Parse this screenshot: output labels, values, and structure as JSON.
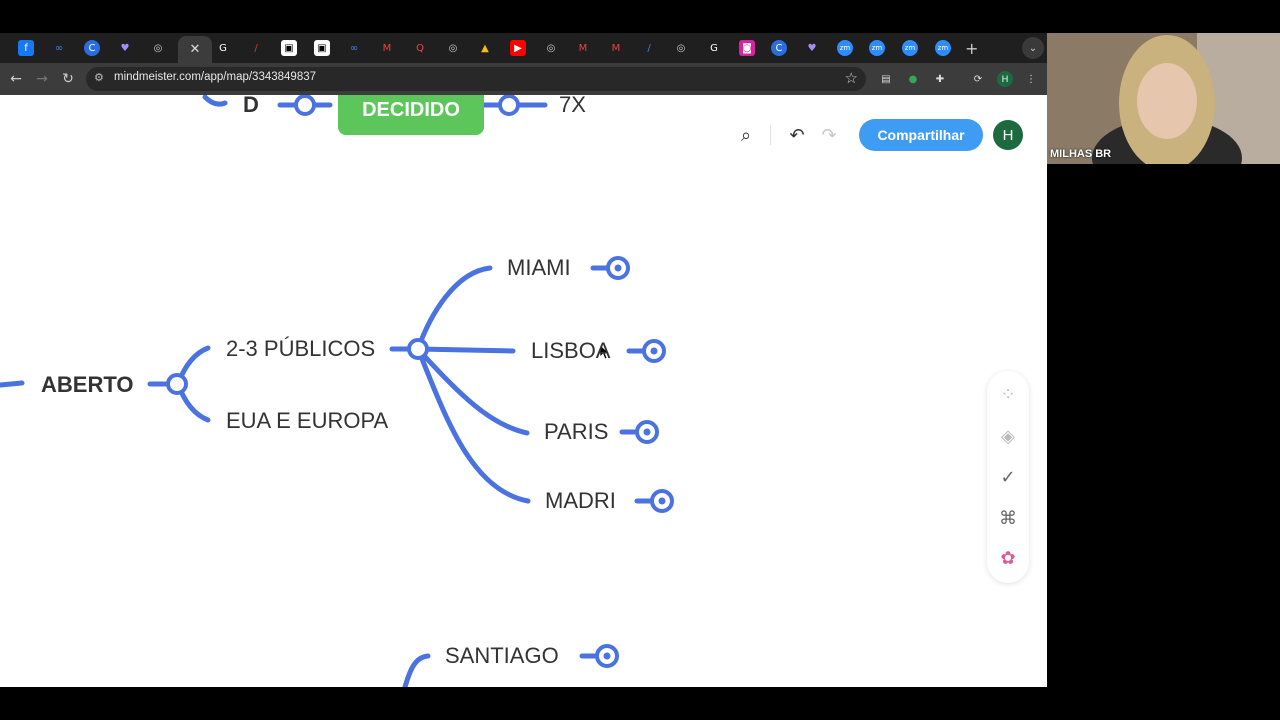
{
  "tabs": {
    "close_glyph": "✕",
    "favicons": [
      "f",
      "∞",
      "C",
      "♥",
      "◎",
      "G",
      "/",
      "▣",
      "▣",
      "∞",
      "M",
      "Q",
      "◎",
      "▲",
      "▶",
      "◎",
      "M",
      "M",
      "/",
      "◎",
      "G",
      "◙",
      "C",
      "♥",
      "zm",
      "zm",
      "zm",
      "zm"
    ],
    "new_tab": "+",
    "menu": "⌄"
  },
  "address_bar": {
    "url": "mindmeister.com/app/map/3343849837",
    "profile_initial": "H"
  },
  "mindmap": {
    "top_left_label": "D",
    "decided_label": "DECIDIDO",
    "top_right_label": "7X",
    "root": "ABERTO",
    "branch_1": "2-3 PÚBLICOS",
    "branch_2": "EUA E EUROPA",
    "cities": [
      "MIAMI",
      "LISBOA",
      "PARIS",
      "MADRI"
    ],
    "bottom_label": "SANTIAGO"
  },
  "toolbar": {
    "share_label": "Compartilhar",
    "avatar_initial": "H"
  },
  "webcam": {
    "label": "MILHAS BR"
  },
  "colors": {
    "branch": "#4a72e0",
    "decided": "#5cc65a",
    "share": "#3e9df2"
  }
}
